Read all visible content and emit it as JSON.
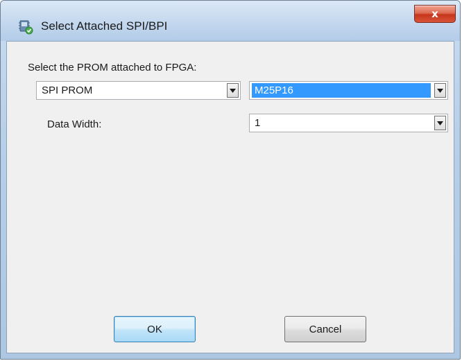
{
  "window": {
    "title": "Select Attached SPI/BPI",
    "close_label": "x"
  },
  "form": {
    "prompt_label": "Select the PROM attached to FPGA:",
    "prom_type": {
      "value": "SPI PROM"
    },
    "prom_part": {
      "value": "M25P16",
      "selected": true
    },
    "data_width_label": "Data Width:",
    "data_width": {
      "value": "1"
    }
  },
  "buttons": {
    "ok_label": "OK",
    "cancel_label": "Cancel"
  },
  "icons": {
    "title": "prom-chip-icon",
    "close": "close-icon",
    "dropdown": "chevron-down-icon"
  },
  "colors": {
    "selection": "#3399ff",
    "close_button": "#c6361b",
    "default_button_border": "#3c7fb1"
  }
}
